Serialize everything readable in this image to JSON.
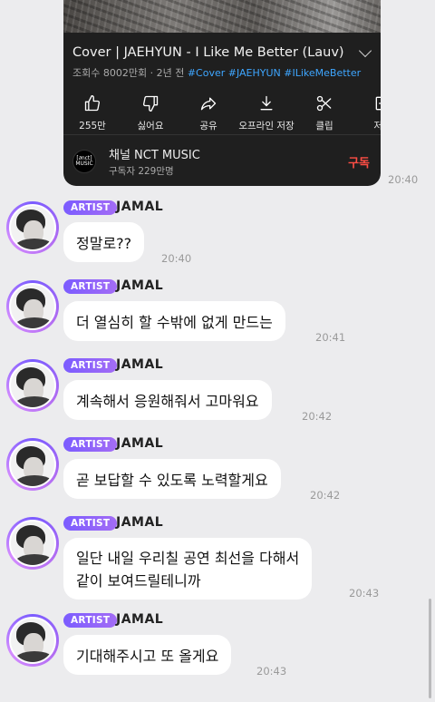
{
  "video": {
    "title": "Cover | JAEHYUN - I Like Me Better (Lauv)",
    "views": "조회수 8002만회",
    "age": "2년 전",
    "hashtags": "#Cover #JAEHYUN #ILikeMeBetter",
    "actions": [
      {
        "label": "255만",
        "icon": "thumbs-up-icon"
      },
      {
        "label": "싫어요",
        "icon": "thumbs-down-icon"
      },
      {
        "label": "공유",
        "icon": "share-icon"
      },
      {
        "label": "오프라인 저장",
        "icon": "download-icon"
      },
      {
        "label": "클립",
        "icon": "scissors-icon"
      },
      {
        "label": "저장",
        "icon": "add-playlist-icon"
      }
    ],
    "channel": {
      "logo_text_top": "[∂nct]",
      "logo_text_bottom": "MUSIC",
      "name": "채널 NCT MUSIC",
      "subscribers": "구독자 229만명",
      "subscribe_label": "구독"
    },
    "time": "20:40"
  },
  "messages": [
    {
      "badge": "ARTIST",
      "sender": "JAMAL",
      "lines": [
        "정말로??"
      ],
      "time": "20:40"
    },
    {
      "badge": "ARTIST",
      "sender": "JAMAL",
      "lines": [
        "더 열심히 할 수밖에 없게 만드는"
      ],
      "time": "20:41"
    },
    {
      "badge": "ARTIST",
      "sender": "JAMAL",
      "lines": [
        "계속해서 응원해줘서 고마워요"
      ],
      "time": "20:42"
    },
    {
      "badge": "ARTIST",
      "sender": "JAMAL",
      "lines": [
        "곧 보답할 수 있도록 노력할게요"
      ],
      "time": "20:42"
    },
    {
      "badge": "ARTIST",
      "sender": "JAMAL",
      "lines": [
        "일단 내일 우리칠 공연 최선을 다해서",
        "같이 보여드릴테니까"
      ],
      "time": "20:43"
    },
    {
      "badge": "ARTIST",
      "sender": "JAMAL",
      "lines": [
        "기대해주시고 또 올게요"
      ],
      "time": "20:43"
    }
  ],
  "colors": {
    "background": "#ececee",
    "badge_gradient_start": "#7b5cff",
    "badge_gradient_end": "#a36cf5",
    "hashtag": "#3ea6ff",
    "subscribe": "#ff4e45",
    "card": "#1f1f1f"
  }
}
